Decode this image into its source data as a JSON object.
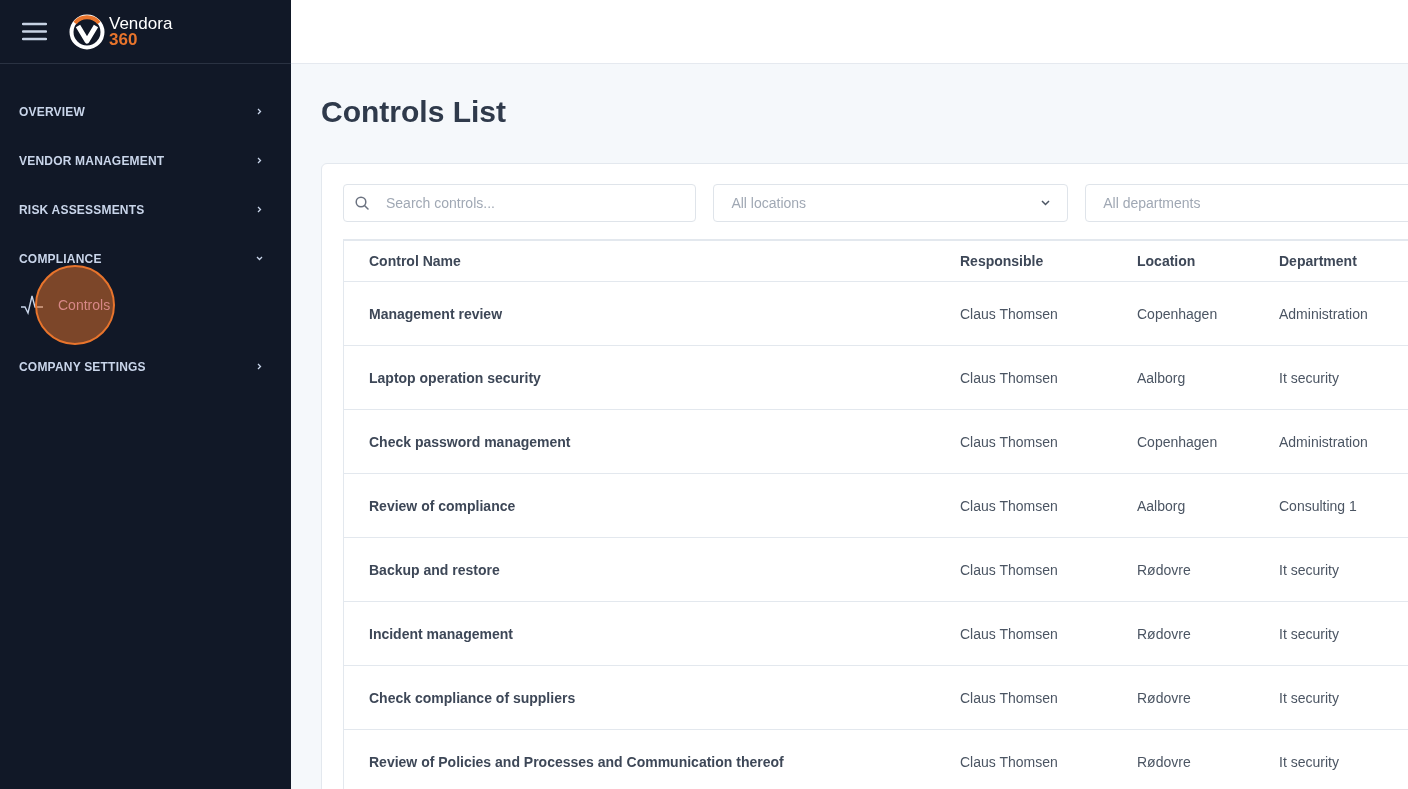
{
  "brand": {
    "name": "Vendora",
    "suffix": "360"
  },
  "sidebar": {
    "items": [
      {
        "label": "OVERVIEW",
        "expanded": false
      },
      {
        "label": "VENDOR MANAGEMENT",
        "expanded": false
      },
      {
        "label": "RISK ASSESSMENTS",
        "expanded": false
      },
      {
        "label": "COMPLIANCE",
        "expanded": true,
        "children": [
          {
            "label": "Controls",
            "selected": true,
            "click_highlight": true
          }
        ]
      },
      {
        "label": "COMPANY SETTINGS",
        "expanded": false
      }
    ]
  },
  "page_title": "Controls List",
  "filters": {
    "search": {
      "placeholder": "Search controls..."
    },
    "location": {
      "placeholder": "All locations"
    },
    "department": {
      "placeholder": "All departments"
    }
  },
  "table": {
    "columns": [
      "Control Name",
      "Responsible",
      "Location",
      "Department"
    ],
    "rows": [
      [
        "Management review",
        "Claus Thomsen",
        "Copenhagen",
        "Administration"
      ],
      [
        "Laptop operation security",
        "Claus Thomsen",
        "Aalborg",
        "It security"
      ],
      [
        "Check password management",
        "Claus Thomsen",
        "Copenhagen",
        "Administration"
      ],
      [
        "Review of compliance",
        "Claus Thomsen",
        "Aalborg",
        "Consulting 1"
      ],
      [
        "Backup and restore",
        "Claus Thomsen",
        "Rødovre",
        "It security"
      ],
      [
        "Incident management",
        "Claus Thomsen",
        "Rødovre",
        "It security"
      ],
      [
        "Check compliance of suppliers",
        "Claus Thomsen",
        "Rødovre",
        "It security"
      ],
      [
        "Review of Policies and Processes and Communication thereof",
        "Claus Thomsen",
        "Rødovre",
        "It security"
      ]
    ]
  }
}
